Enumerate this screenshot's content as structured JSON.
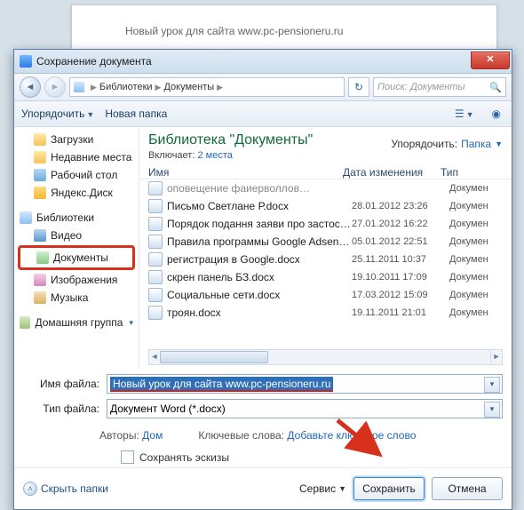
{
  "bgdoc_title": "Новый урок для сайта www.pc-pensioneru.ru",
  "dialog_title": "Сохранение документа",
  "breadcrumbs": {
    "p1": "Библиотеки",
    "p2": "Документы"
  },
  "search_placeholder": "Поиск: Документы",
  "toolbar": {
    "organize": "Упорядочить",
    "newfolder": "Новая папка"
  },
  "sidebar": {
    "fav": [
      {
        "label": "Загрузки"
      },
      {
        "label": "Недавние места"
      },
      {
        "label": "Рабочий стол"
      },
      {
        "label": "Яндекс.Диск"
      }
    ],
    "lib_header": "Библиотеки",
    "lib": [
      {
        "label": "Видео"
      },
      {
        "label": "Документы"
      },
      {
        "label": "Изображения"
      },
      {
        "label": "Музыка"
      }
    ],
    "homegroup": "Домашняя группа"
  },
  "library": {
    "title": "Библиотека \"Документы\"",
    "includes_label": "Включает:",
    "includes_value": "2 места",
    "sort_label": "Упорядочить:",
    "sort_value": "Папка"
  },
  "columns": {
    "name": "Имя",
    "date": "Дата изменения",
    "type": "Тип"
  },
  "files": [
    {
      "name": "оповещение фаиерволлов…",
      "date": "",
      "type": "Докумен",
      "cut": true
    },
    {
      "name": "Письмо Светлане Р.docx",
      "date": "28.01.2012 23:26",
      "type": "Докумен"
    },
    {
      "name": "Порядок подання заяви про застосува...",
      "date": "27.01.2012 16:22",
      "type": "Докумен"
    },
    {
      "name": "Правила программы Google Adsense.d...",
      "date": "05.01.2012 22:51",
      "type": "Докумен"
    },
    {
      "name": "регистрация в Google.docx",
      "date": "25.11.2011 10:37",
      "type": "Докумен"
    },
    {
      "name": "скрен панель БЗ.docx",
      "date": "19.10.2011 17:09",
      "type": "Докумен"
    },
    {
      "name": "Социальные сети.docx",
      "date": "17.03.2012 15:09",
      "type": "Докумен"
    },
    {
      "name": "троян.docx",
      "date": "19.11.2011 21:01",
      "type": "Докумен"
    }
  ],
  "form": {
    "filename_label": "Имя файла:",
    "filename_value": "Новый урок для сайта www.pc-pensioneru.ru",
    "filetype_label": "Тип файла:",
    "filetype_value": "Документ Word (*.docx)"
  },
  "meta": {
    "authors_label": "Авторы:",
    "authors_value": "Дом",
    "keywords_label": "Ключевые слова:",
    "keywords_value": "Добавьте ключевое слово"
  },
  "checkbox_label": "Сохранять эскизы",
  "footer": {
    "hide": "Скрыть папки",
    "service": "Сервис",
    "save": "Сохранить",
    "cancel": "Отмена"
  }
}
